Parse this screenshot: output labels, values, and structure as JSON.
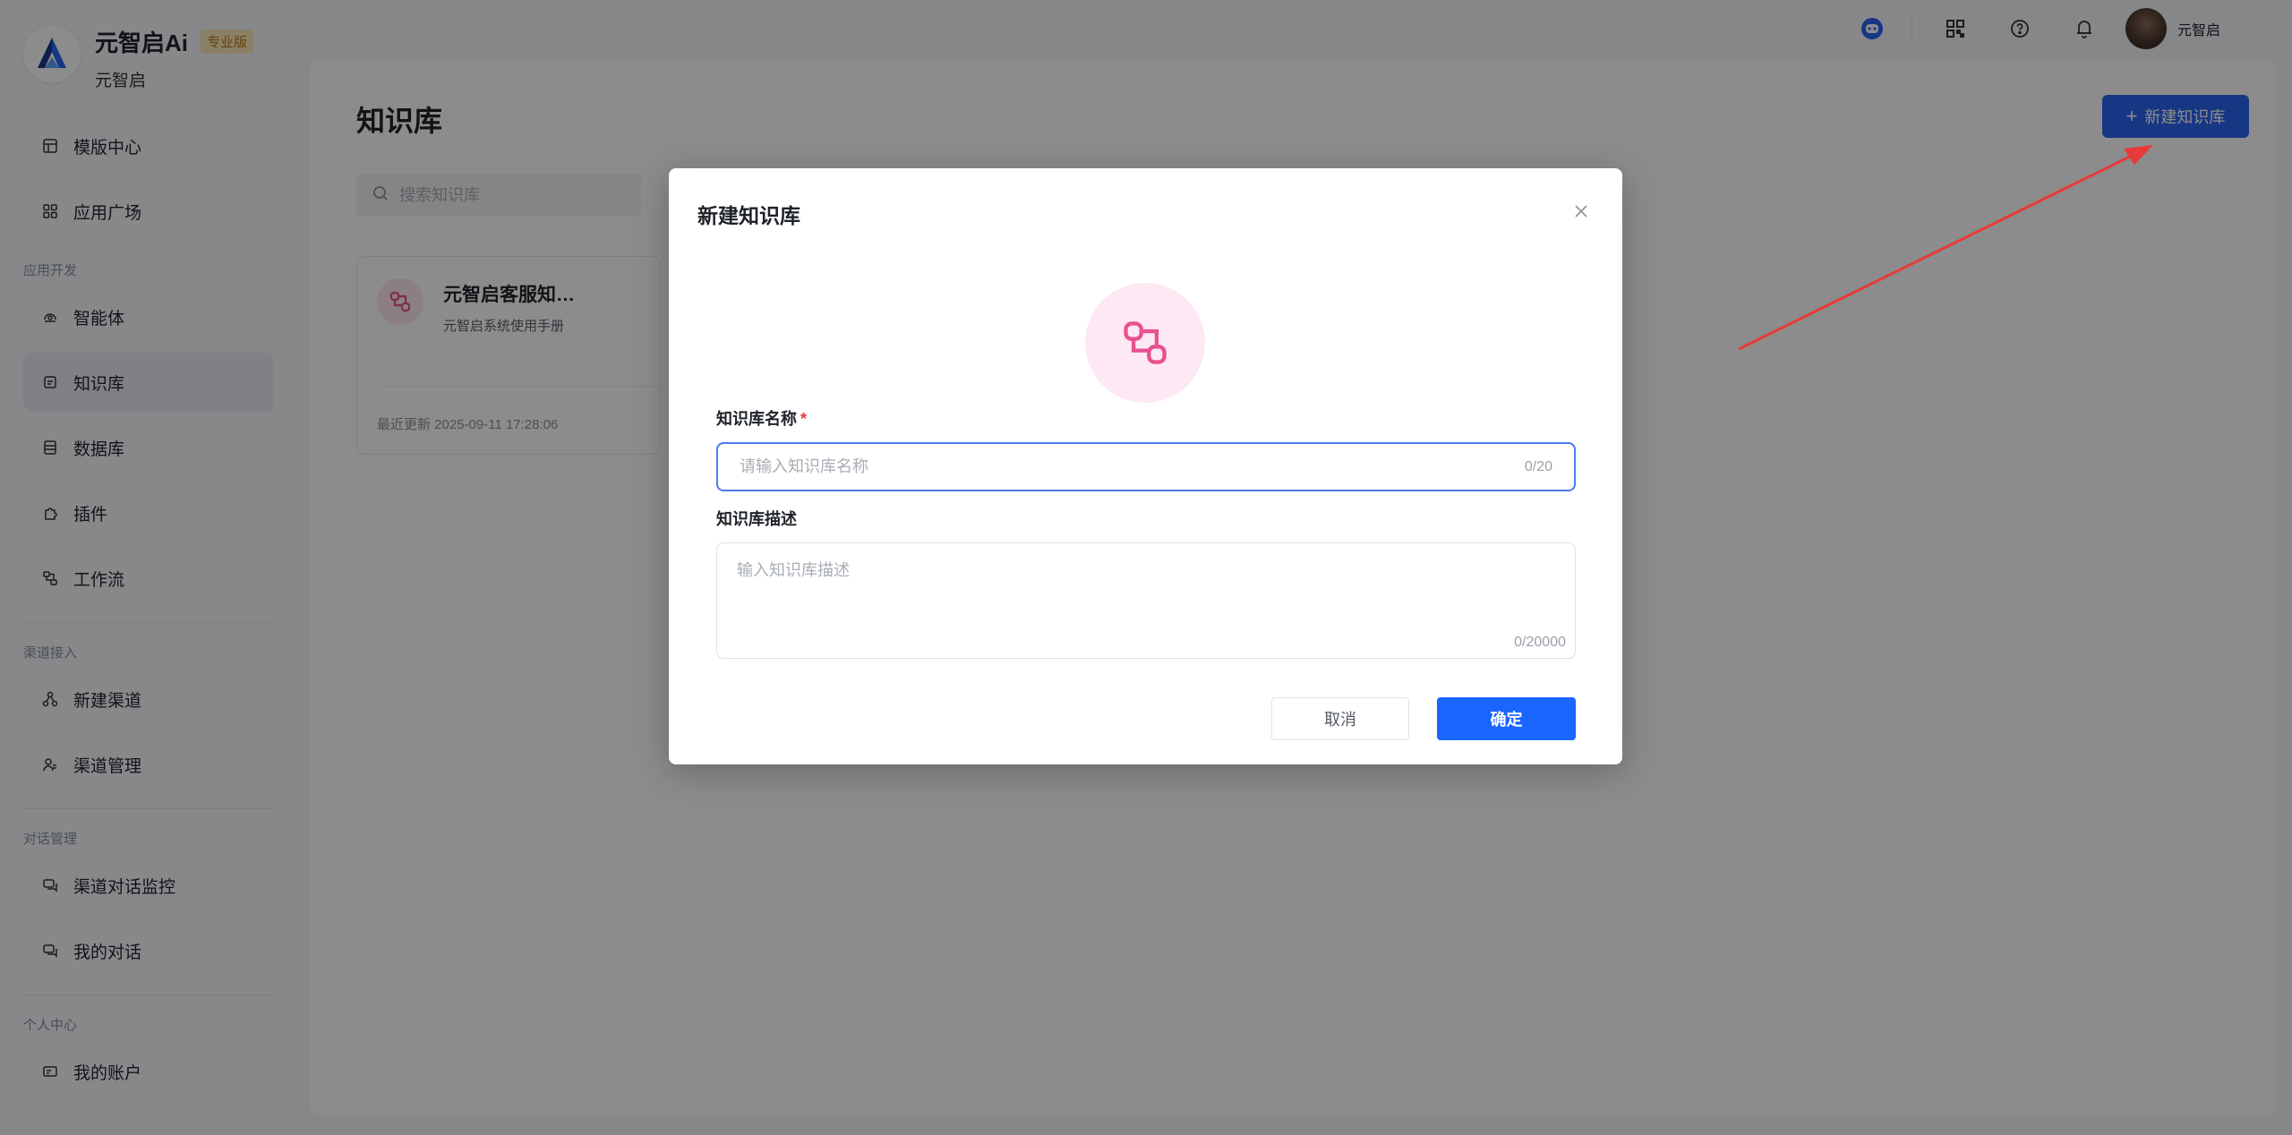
{
  "brand": {
    "name": "元智启Ai",
    "badge": "专业版",
    "subtitle": "元智启"
  },
  "sidebar": {
    "items_top": [
      {
        "label": "模版中心",
        "icon": "template-icon"
      },
      {
        "label": "应用广场",
        "icon": "grid-icon"
      }
    ],
    "section_dev": "应用开发",
    "items_dev": [
      {
        "label": "智能体",
        "icon": "agent-icon"
      },
      {
        "label": "知识库",
        "icon": "knowledge-icon",
        "active": true
      },
      {
        "label": "数据库",
        "icon": "database-icon"
      },
      {
        "label": "插件",
        "icon": "plugin-icon"
      },
      {
        "label": "工作流",
        "icon": "workflow-icon"
      }
    ],
    "section_channel": "渠道接入",
    "items_channel": [
      {
        "label": "新建渠道",
        "icon": "channel-new-icon"
      },
      {
        "label": "渠道管理",
        "icon": "channel-manage-icon"
      }
    ],
    "section_chat": "对话管理",
    "items_chat": [
      {
        "label": "渠道对话监控",
        "icon": "chat-monitor-icon"
      },
      {
        "label": "我的对话",
        "icon": "chat-icon"
      }
    ],
    "section_personal": "个人中心",
    "items_personal": [
      {
        "label": "我的账户",
        "icon": "account-icon"
      }
    ]
  },
  "header": {
    "user_name": "元智启"
  },
  "main": {
    "title": "知识库",
    "new_button": "新建知识库",
    "search_placeholder": "搜索知识库",
    "card": {
      "title": "元智启客服知…",
      "desc": "元智启系统使用手册",
      "updated": "最近更新 2025-09-11 17:28:06"
    }
  },
  "modal": {
    "title": "新建知识库",
    "name_label": "知识库名称",
    "required_mark": "*",
    "name_placeholder": "请输入知识库名称",
    "name_counter": "0/20",
    "desc_label": "知识库描述",
    "desc_placeholder": "输入知识库描述",
    "desc_counter": "0/20000",
    "cancel": "取消",
    "confirm": "确定"
  },
  "colors": {
    "primary": "#1a66ff",
    "accent_pink": "#e8508f",
    "arrow": "#e83a3a"
  }
}
